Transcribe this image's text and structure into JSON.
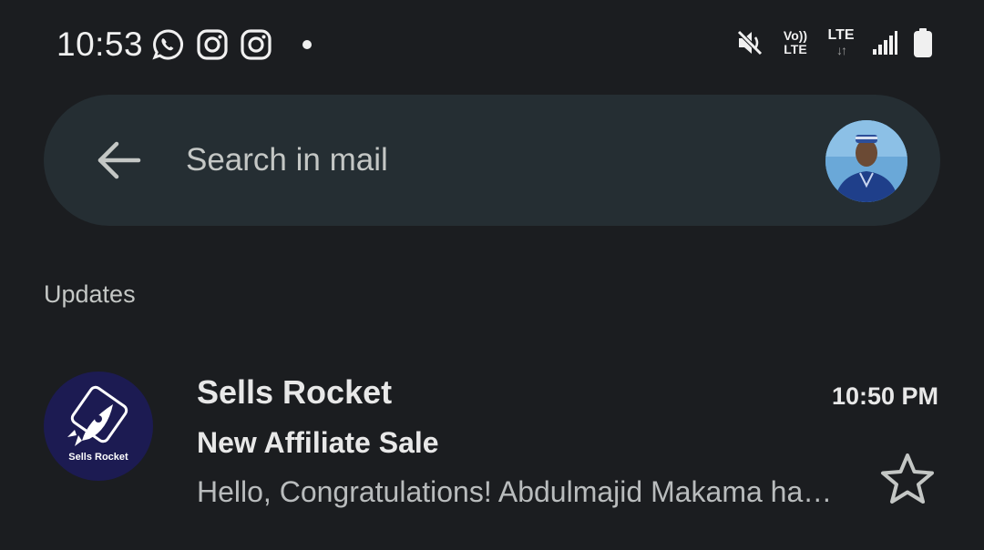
{
  "status_bar": {
    "time": "10:53",
    "left_icons": [
      "whatsapp-icon",
      "instagram-icon",
      "instagram-icon",
      "notification-dot-icon"
    ],
    "volte_line1": "Vo))",
    "volte_line2": "LTE",
    "lte_label": "LTE",
    "lte_arrows": "↓↑",
    "right_icons": [
      "mute-icon",
      "volte-icon",
      "lte-icon",
      "signal-icon",
      "battery-icon"
    ]
  },
  "search": {
    "placeholder": "Search in mail",
    "back_icon": "arrow-left-icon"
  },
  "section": {
    "label": "Updates"
  },
  "mail": {
    "sender": "Sells Rocket",
    "logo_text": "Sells Rocket",
    "time": "10:50 PM",
    "subject": "New Affiliate Sale",
    "snippet": "Hello, Congratulations! Abdulmajid Makama has made a sale",
    "starred": false
  },
  "colors": {
    "background": "#1b1d20",
    "search_bar": "#252e33",
    "logo_bg": "#1c1b52"
  }
}
